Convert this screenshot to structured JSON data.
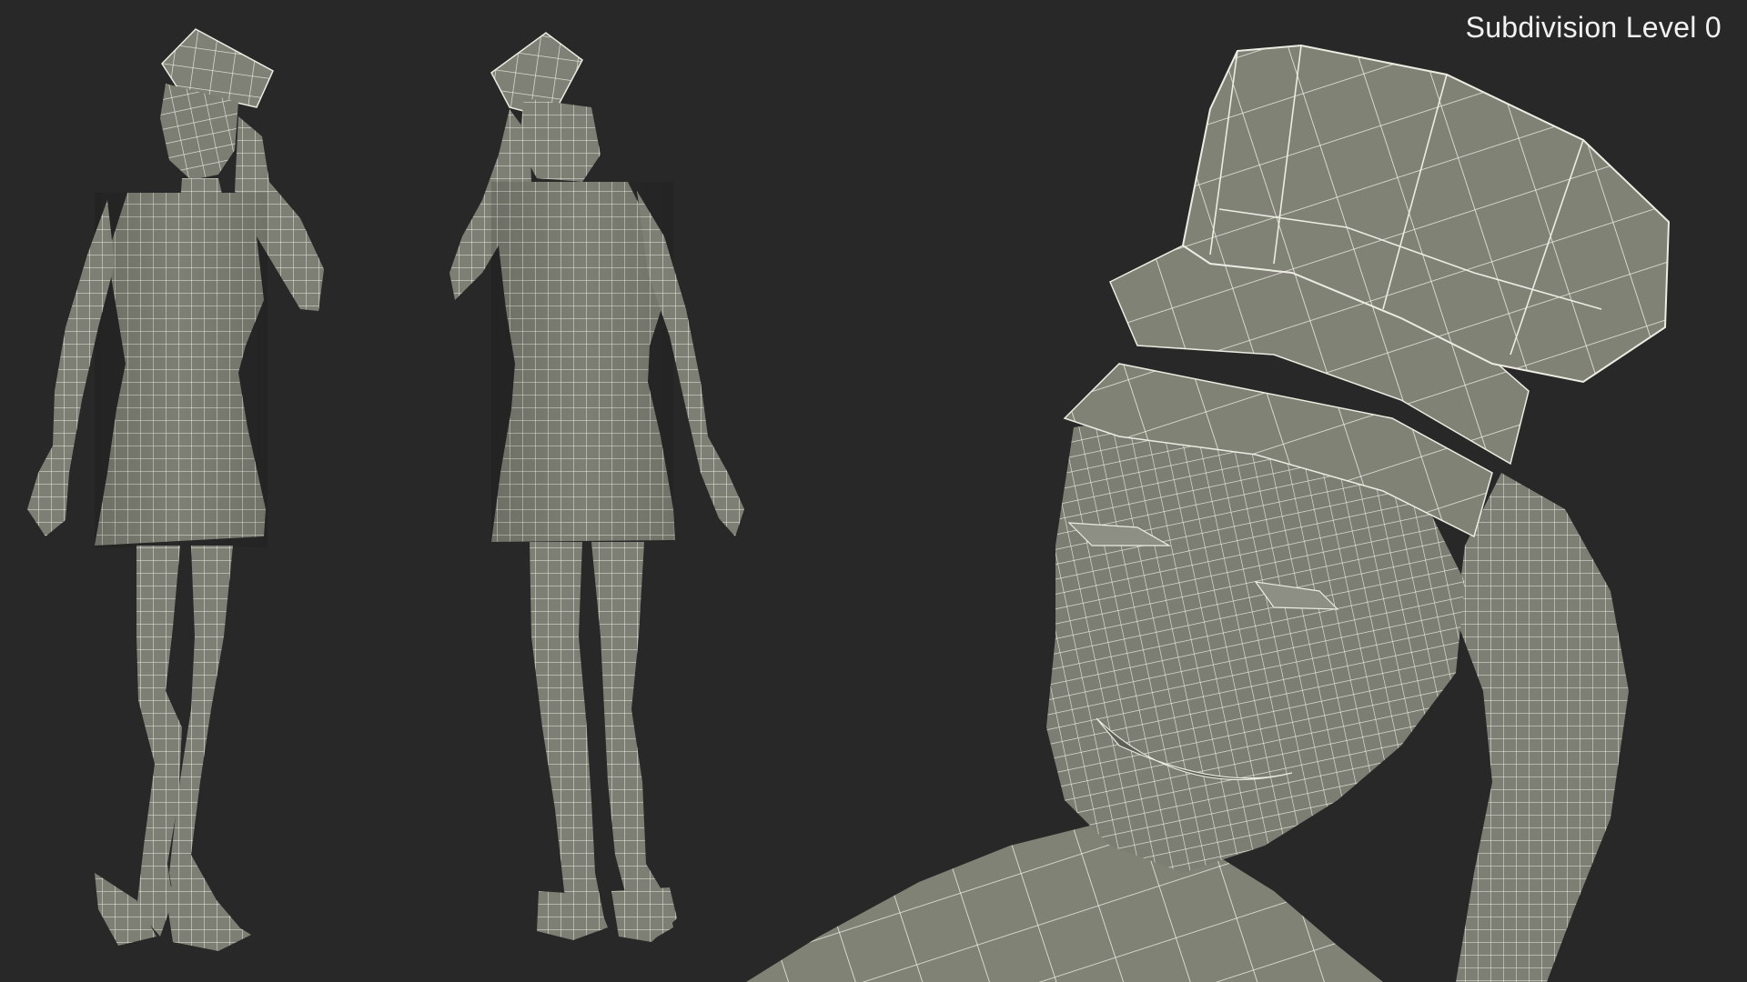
{
  "viewport": {
    "subdivision_label": "Subdivision Level 0",
    "background_color": "#282828",
    "mesh_fill_color": "#7d7f74",
    "wire_color": "#f0f0e6"
  },
  "views": [
    {
      "name": "front-three-quarter-full-body"
    },
    {
      "name": "back-full-body"
    },
    {
      "name": "head-closeup"
    }
  ]
}
